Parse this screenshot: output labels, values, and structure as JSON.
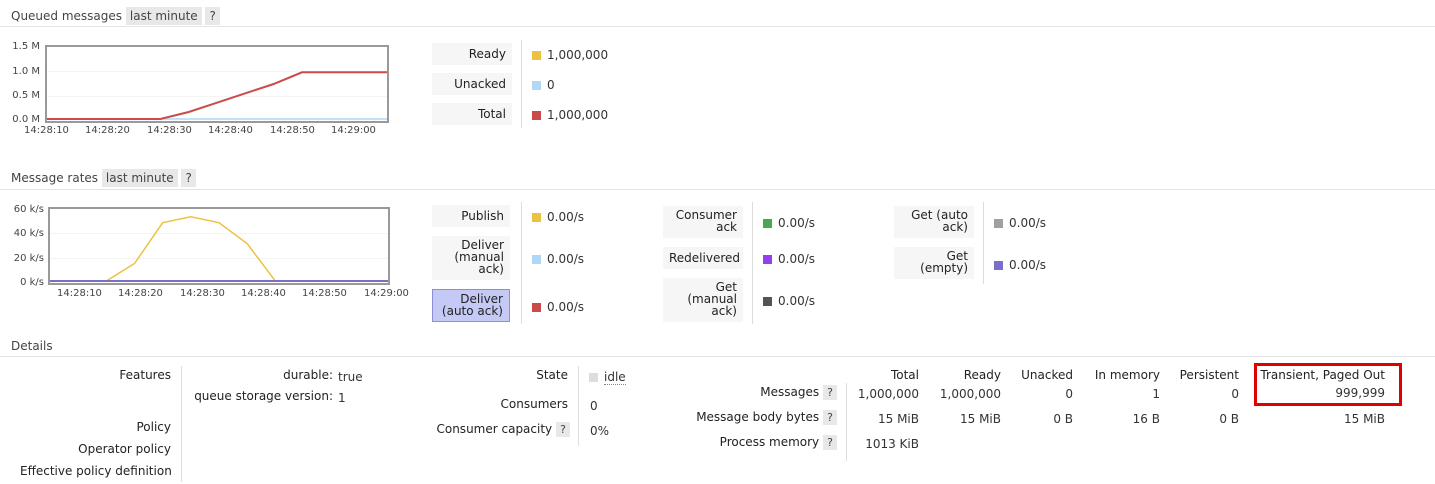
{
  "queued": {
    "title": "Queued messages",
    "range": "last minute",
    "help": "?",
    "yticks": [
      "1.5 M",
      "1.0 M",
      "0.5 M",
      "0.0 M"
    ],
    "xticks": [
      "14:28:10",
      "14:28:20",
      "14:28:30",
      "14:28:40",
      "14:28:50",
      "14:29:00"
    ],
    "legend": [
      {
        "label": "Ready",
        "value": "1,000,000",
        "color": "#edc240"
      },
      {
        "label": "Unacked",
        "value": "0",
        "color": "#afd8f8"
      },
      {
        "label": "Total",
        "value": "1,000,000",
        "color": "#cb4b4b"
      }
    ]
  },
  "rates": {
    "title": "Message rates",
    "range": "last minute",
    "help": "?",
    "yticks": [
      "60 k/s",
      "40 k/s",
      "20 k/s",
      "0 k/s"
    ],
    "xticks": [
      "14:28:10",
      "14:28:20",
      "14:28:30",
      "14:28:40",
      "14:28:50",
      "14:29:00"
    ],
    "col1": [
      {
        "label": "Publish",
        "value": "0.00/s",
        "color": "#edc240"
      },
      {
        "label": "Deliver (manual ack)",
        "value": "0.00/s",
        "color": "#afd8f8"
      },
      {
        "label": "Deliver (auto ack)",
        "value": "0.00/s",
        "color": "#cb4b4b"
      }
    ],
    "col2": [
      {
        "label": "Consumer ack",
        "value": "0.00/s",
        "color": "#4da74d"
      },
      {
        "label": "Redelivered",
        "value": "0.00/s",
        "color": "#9440ed"
      },
      {
        "label": "Get (manual ack)",
        "value": "0.00/s",
        "color": "#545454"
      }
    ],
    "col3": [
      {
        "label": "Get (auto ack)",
        "value": "0.00/s",
        "color": "#a0a0a0"
      },
      {
        "label": "Get (empty)",
        "value": "0.00/s",
        "color": "#7a6fc7"
      }
    ]
  },
  "chart_data": [
    {
      "type": "line",
      "title": "Queued messages",
      "x": [
        "14:28:05",
        "14:28:10",
        "14:28:15",
        "14:28:20",
        "14:28:25",
        "14:28:30",
        "14:28:35",
        "14:28:40",
        "14:28:45",
        "14:28:50",
        "14:28:55",
        "14:29:00",
        "14:29:05"
      ],
      "ylim": [
        0,
        1500000
      ],
      "series": [
        {
          "name": "Ready",
          "values": [
            0,
            0,
            0,
            0,
            0,
            150000,
            350000,
            550000,
            750000,
            1000000,
            1000000,
            1000000,
            1000000
          ]
        },
        {
          "name": "Unacked",
          "values": [
            0,
            0,
            0,
            0,
            0,
            0,
            0,
            0,
            0,
            0,
            0,
            0,
            0
          ]
        },
        {
          "name": "Total",
          "values": [
            0,
            0,
            0,
            0,
            0,
            150000,
            350000,
            550000,
            750000,
            1000000,
            1000000,
            1000000,
            1000000
          ]
        }
      ]
    },
    {
      "type": "line",
      "title": "Message rates",
      "x": [
        "14:28:05",
        "14:28:10",
        "14:28:15",
        "14:28:20",
        "14:28:25",
        "14:28:30",
        "14:28:35",
        "14:28:40",
        "14:28:45",
        "14:28:50",
        "14:28:55",
        "14:29:00",
        "14:29:05"
      ],
      "ylim": [
        0,
        60000
      ],
      "series": [
        {
          "name": "Publish",
          "values": [
            0,
            0,
            0,
            15000,
            50000,
            55000,
            50000,
            32000,
            0,
            0,
            0,
            0,
            0
          ]
        },
        {
          "name": "Deliver (auto ack)",
          "values": [
            0,
            0,
            0,
            0,
            0,
            0,
            0,
            0,
            0,
            0,
            0,
            0,
            0
          ]
        }
      ]
    }
  ],
  "details": {
    "title": "Details",
    "features_label": "Features",
    "durable_key": "durable:",
    "durable_val": "true",
    "qsv_key": "queue storage version:",
    "qsv_val": "1",
    "policy_label": "Policy",
    "operator_policy_label": "Operator policy",
    "effective_policy_label": "Effective policy definition",
    "state_label": "State",
    "state_val": "idle",
    "consumers_label": "Consumers",
    "consumers_val": "0",
    "capacity_label": "Consumer capacity",
    "capacity_val": "0%",
    "help": "?",
    "table": {
      "headers": [
        "Total",
        "Ready",
        "Unacked",
        "In memory",
        "Persistent",
        "Transient, Paged Out"
      ],
      "rows": [
        {
          "label": "Messages",
          "cells": [
            "1,000,000",
            "1,000,000",
            "0",
            "1",
            "0",
            "999,999"
          ]
        },
        {
          "label": "Message body bytes",
          "cells": [
            "15 MiB",
            "15 MiB",
            "0 B",
            "16 B",
            "0 B",
            "15 MiB"
          ]
        },
        {
          "label": "Process memory",
          "cells": [
            "1013 KiB",
            "",
            "",
            "",
            "",
            ""
          ]
        }
      ]
    }
  }
}
